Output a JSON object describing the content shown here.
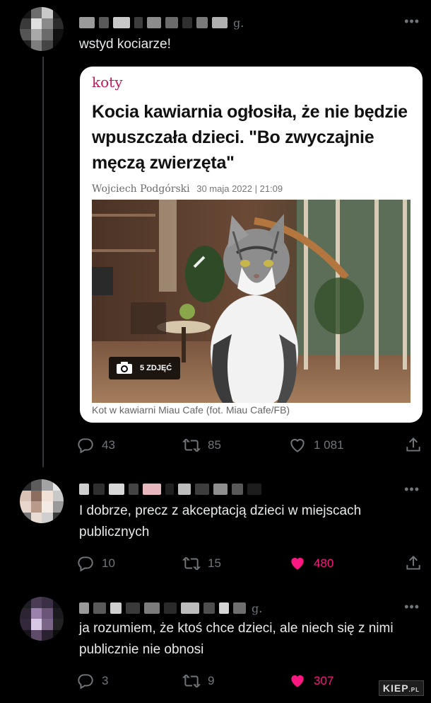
{
  "tweets": [
    {
      "text": "wstyd kociarze!",
      "handle_tail": "g.",
      "stats": {
        "replies": "43",
        "retweets": "85",
        "likes": "1 081",
        "liked": false
      }
    },
    {
      "text": "I dobrze, precz z akceptacją dzieci w miejscach publicznych",
      "handle_tail": "",
      "stats": {
        "replies": "10",
        "retweets": "15",
        "likes": "480",
        "liked": true
      }
    },
    {
      "text": "ja rozumiem, że ktoś chce dzieci, ale niech się z nimi publicznie nie obnosi",
      "handle_tail": "g.",
      "stats": {
        "replies": "3",
        "retweets": "9",
        "likes": "307",
        "liked": true
      }
    }
  ],
  "article": {
    "category": "koty",
    "title": "Kocia kawiarnia ogłosiła, że nie będzie wpuszczała dzieci. \"Bo zwyczajnie męczą zwierzęta\"",
    "author": "Wojciech Podgórski",
    "date": "30 maja 2022 | 21:09",
    "photo_badge": "5 ZDJĘĆ",
    "caption": "Kot w kawiarni Miau Cafe (fot. Miau Cafe/FB)"
  },
  "icons": {
    "reply": "reply-icon",
    "retweet": "retweet-icon",
    "like": "heart-icon",
    "share": "share-icon",
    "more": "more-icon",
    "camera": "camera-icon"
  },
  "colors": {
    "background": "#000000",
    "text": "#e7e9ea",
    "muted": "#71767b",
    "like": "#f91880",
    "category": "#c2185b"
  },
  "more_label": "•••",
  "watermark": {
    "main": "KIEP",
    "suffix": ".PL"
  }
}
